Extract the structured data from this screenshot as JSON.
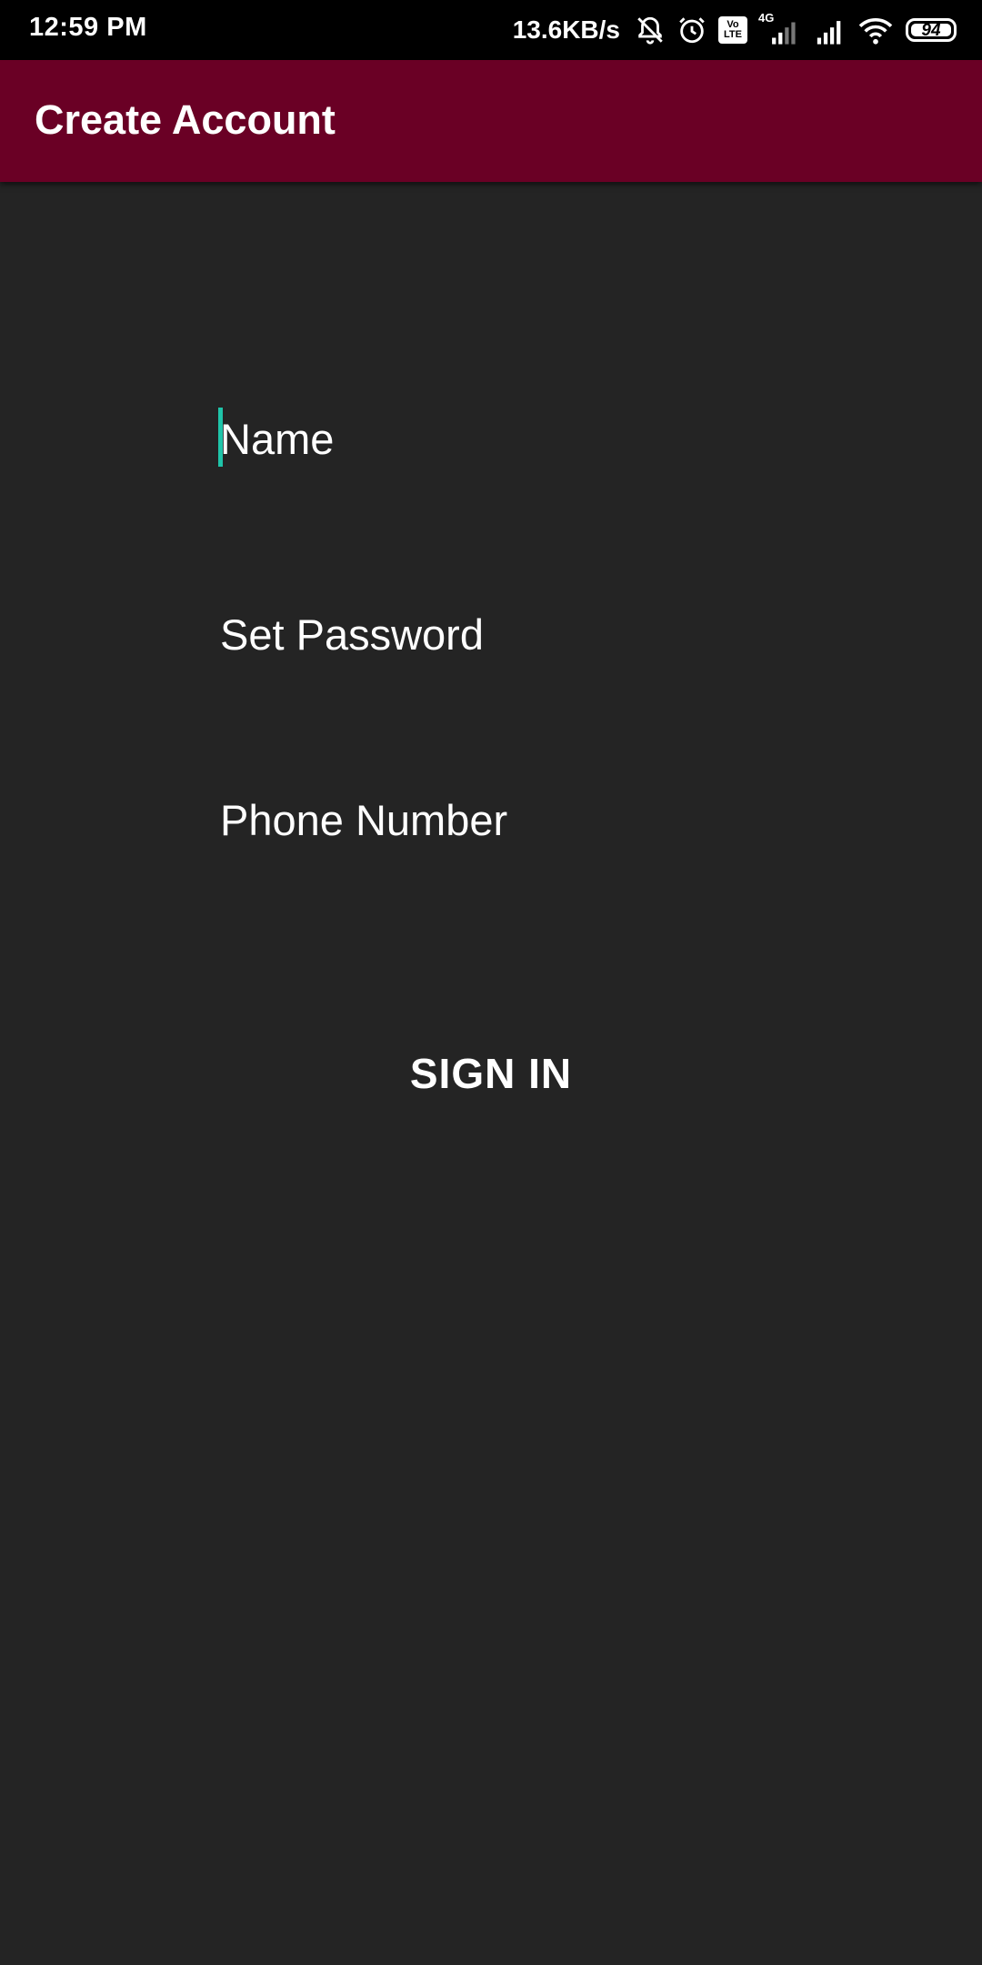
{
  "status_bar": {
    "time": "12:59 PM",
    "net_speed": "13.6KB/s",
    "icons": [
      "muted-bell-icon",
      "alarm-icon",
      "volte-icon",
      "signal-4g-icon",
      "signal-icon",
      "wifi-icon"
    ],
    "volte_top": "Vo",
    "volte_bottom": "LTE",
    "network_type": "4G",
    "battery_level": "94"
  },
  "app_bar": {
    "title": "Create Account",
    "color": "#6a0025"
  },
  "form": {
    "name_placeholder": "Name",
    "password_placeholder": "Set Password",
    "phone_placeholder": "Phone Number",
    "submit_label": "SIGN IN"
  },
  "colors": {
    "background": "#242424",
    "accent": "#1fc4a9"
  }
}
